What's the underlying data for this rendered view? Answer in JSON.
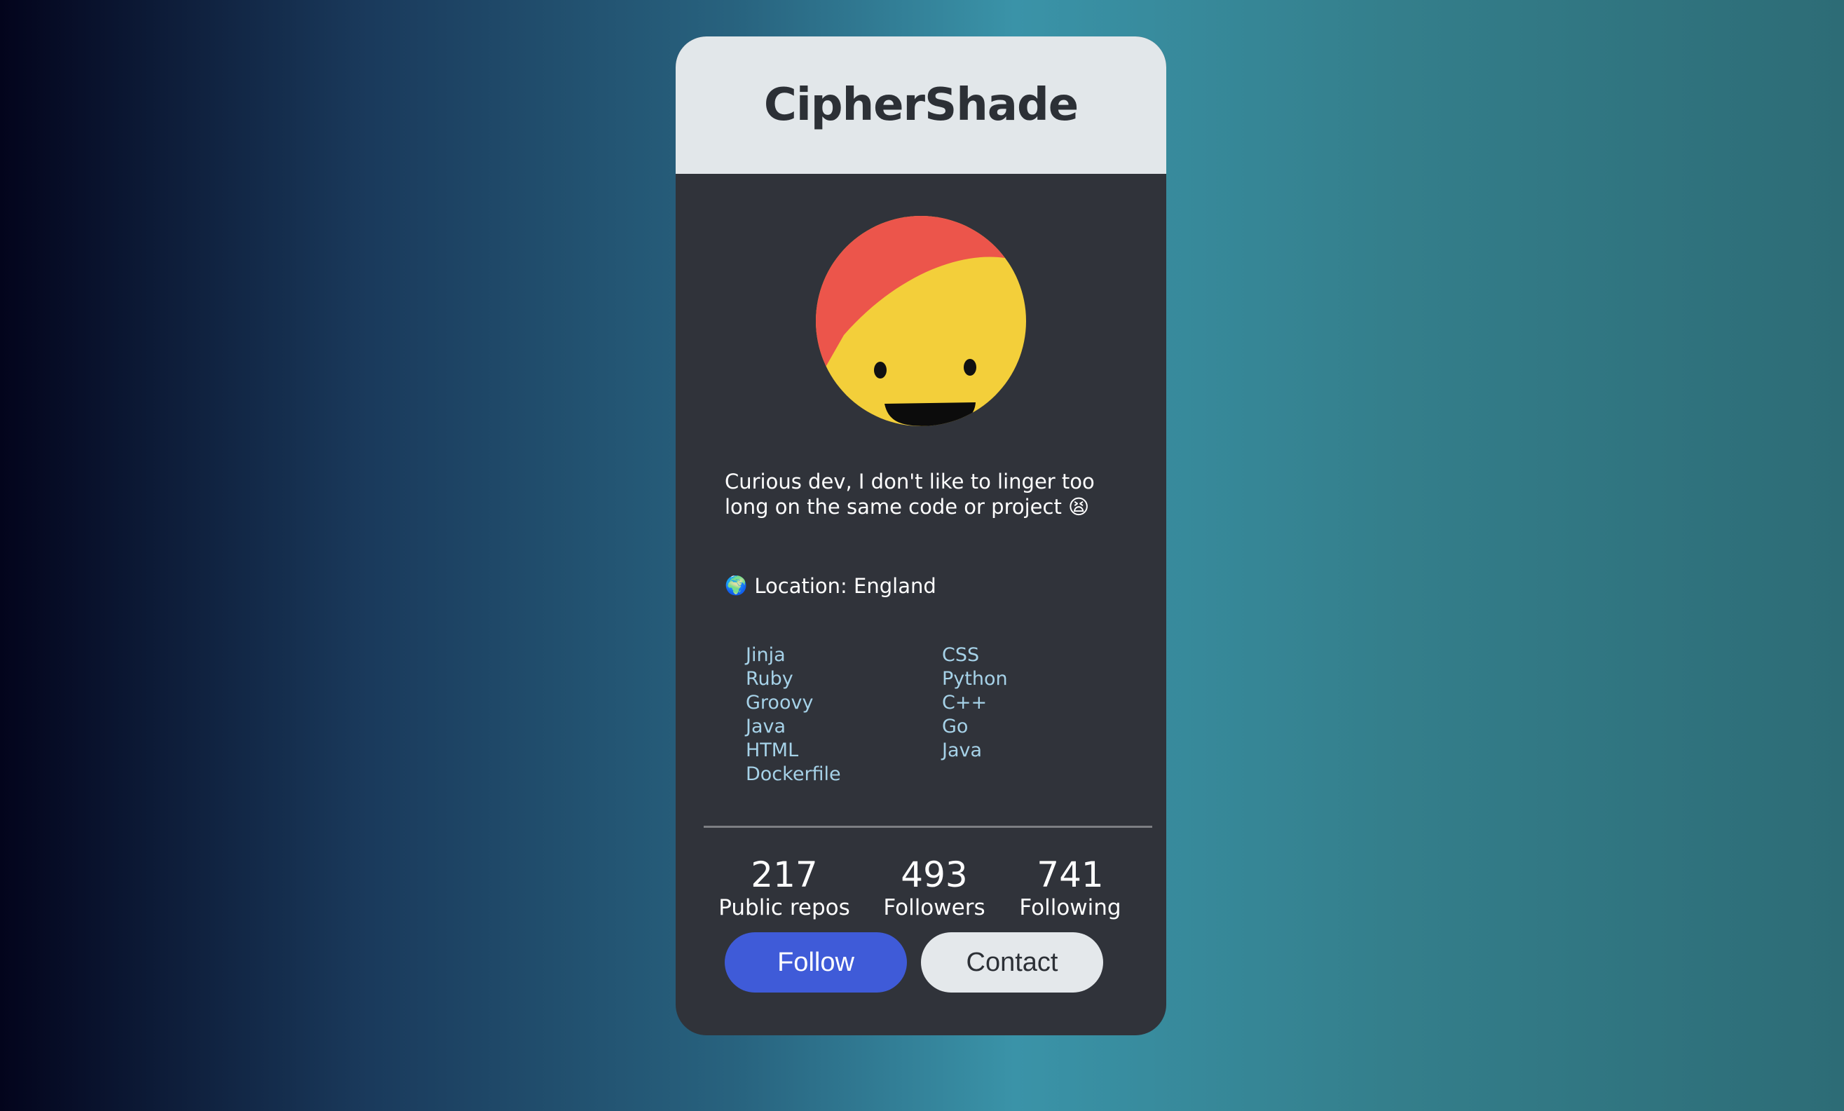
{
  "profile": {
    "name": "CipherShade",
    "bio": "Curious dev, I don't like to linger too long on the same code or project 😫",
    "location_icon": "🌍",
    "location": "Location: England"
  },
  "languages": {
    "left": [
      "Jinja",
      "Ruby",
      "Groovy",
      "Java",
      "HTML",
      "Dockerfile"
    ],
    "right": [
      "CSS",
      "Python",
      "C++",
      "Go",
      "Java"
    ]
  },
  "stats": [
    {
      "value": "217",
      "label": "Public repos"
    },
    {
      "value": "493",
      "label": "Followers"
    },
    {
      "value": "741",
      "label": "Following"
    }
  ],
  "buttons": {
    "follow": "Follow",
    "contact": "Contact"
  },
  "colors": {
    "card_bg": "#30333a",
    "header_bg": "#e2e7ea",
    "follow_bg": "#3f5bd8",
    "contact_bg": "#e4e8eb",
    "language_text": "#a6d2e8"
  },
  "icons": {
    "avatar": "smiley-face-avatar",
    "location": "globe-icon"
  }
}
